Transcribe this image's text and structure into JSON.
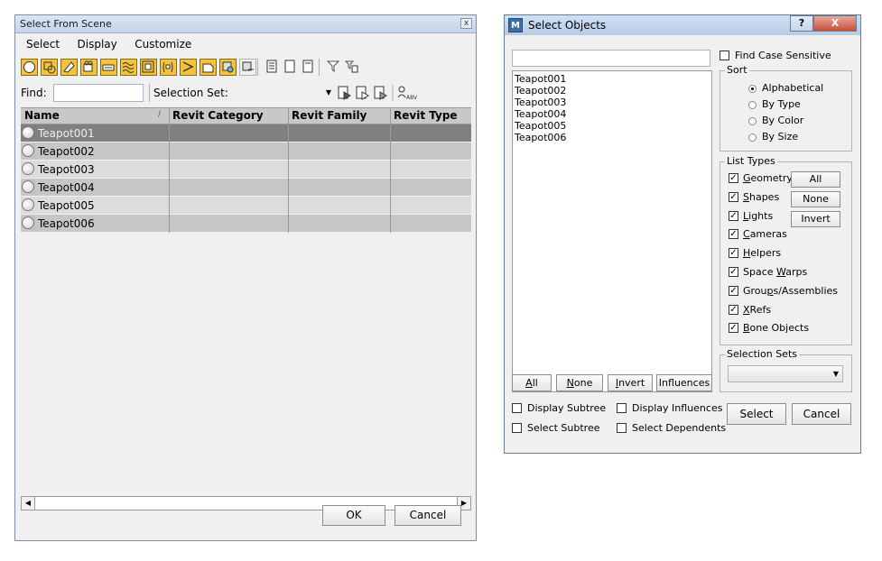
{
  "scene_dialog": {
    "title": "Select From Scene",
    "close_glyph": "x",
    "menu": [
      "Select",
      "Display",
      "Customize"
    ],
    "toolbar_icons": [
      "geometry-filter-icon",
      "shapes-filter-icon",
      "lights-filter-icon",
      "cameras-filter-icon",
      "helpers-filter-icon",
      "space-warps-filter-icon",
      "groups-filter-icon",
      "xrefs-filter-icon",
      "bones-filter-icon",
      "containers-filter-icon",
      "frozen-filter-icon",
      "hidden-filter-icon",
      "list-view-icon",
      "select-all-icon",
      "select-none-icon",
      "filter-icon",
      "filter-options-icon"
    ],
    "find_label": "Find:",
    "find_value": "",
    "selection_set_label": "Selection Set:",
    "selection_set_value": "",
    "columns": [
      "Name",
      "Revit Category",
      "Revit Family",
      "Revit Type"
    ],
    "sort_glyph": "/",
    "rows": [
      "Teapot001",
      "Teapot002",
      "Teapot003",
      "Teapot004",
      "Teapot005",
      "Teapot006"
    ],
    "selected_row": 0,
    "ok_label": "OK",
    "cancel_label": "Cancel",
    "colors": {
      "selection_highlight": "#808080",
      "toolbar_active": "#f5c33b"
    }
  },
  "objects_dialog": {
    "title": "Select Objects",
    "app_icon_letter": "M",
    "help_glyph": "?",
    "close_glyph": "X",
    "search_value": "",
    "items": [
      "Teapot001",
      "Teapot002",
      "Teapot003",
      "Teapot004",
      "Teapot005",
      "Teapot006"
    ],
    "find_case_label": "Find Case Sensitive",
    "sort_group": "Sort",
    "sort_options": [
      "Alphabetical",
      "By Type",
      "By Color",
      "By Size"
    ],
    "sort_selected": 0,
    "list_types_group": "List Types",
    "list_types": [
      {
        "pre": "",
        "u": "G",
        "post": "eometry",
        "checked": true
      },
      {
        "pre": "",
        "u": "S",
        "post": "hapes",
        "checked": true
      },
      {
        "pre": "",
        "u": "L",
        "post": "ights",
        "checked": true
      },
      {
        "pre": "",
        "u": "C",
        "post": "ameras",
        "checked": true
      },
      {
        "pre": "",
        "u": "H",
        "post": "elpers",
        "checked": true
      },
      {
        "pre": "Space ",
        "u": "W",
        "post": "arps",
        "checked": true
      },
      {
        "pre": "Grou",
        "u": "p",
        "post": "s/Assemblies",
        "checked": true
      },
      {
        "pre": "",
        "u": "X",
        "post": "Refs",
        "checked": true
      },
      {
        "pre": "",
        "u": "B",
        "post": "one Objects",
        "checked": true
      }
    ],
    "check_glyph": "✓",
    "list_type_buttons": [
      "All",
      "None",
      "Invert"
    ],
    "selection_sets_group": "Selection Sets",
    "selection_sets_value": "",
    "bottom_buttons": [
      {
        "pre": "",
        "u": "A",
        "post": "ll"
      },
      {
        "pre": "",
        "u": "N",
        "post": "one"
      },
      {
        "pre": "",
        "u": "I",
        "post": "nvert"
      },
      {
        "pre": "",
        "u": "",
        "post": "Influences"
      }
    ],
    "checkboxes_left": [
      "Display Subtree",
      "Select Subtree"
    ],
    "checkboxes_right": [
      "Display Influences",
      "Select Dependents"
    ],
    "select_label": "Select",
    "cancel_label": "Cancel"
  }
}
